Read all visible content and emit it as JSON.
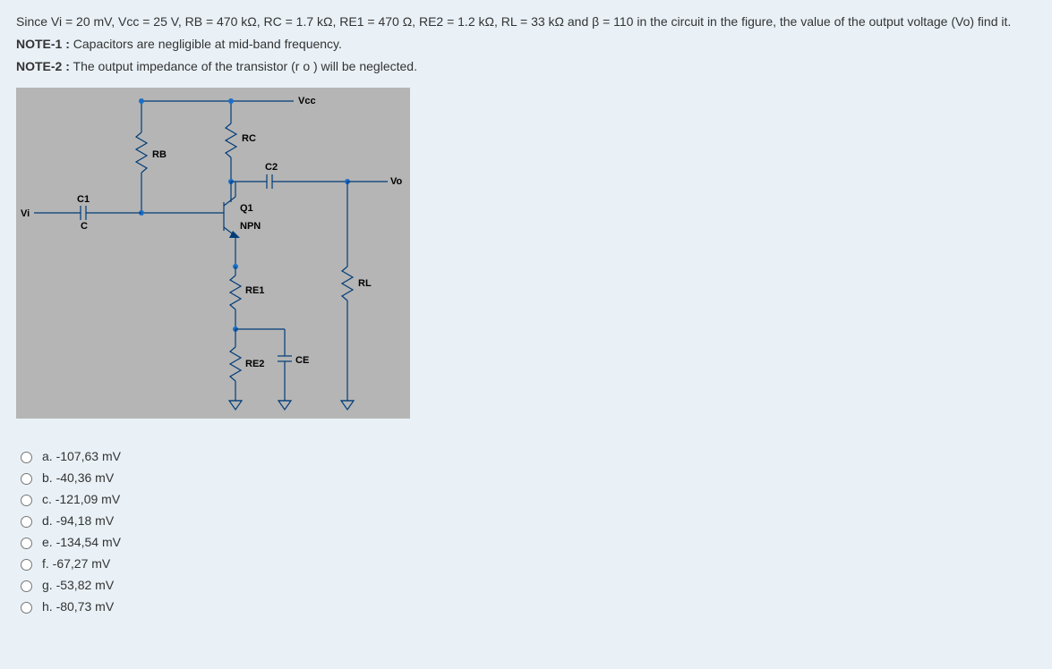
{
  "question": {
    "line1": "Since Vi = 20 mV, Vcc = 25 V, RB = 470 kΩ, RC = 1.7 kΩ, RE1 = 470 Ω, RE2 = 1.2 kΩ, RL = 33 kΩ and β = 110 in the circuit in the figure, the value of the output voltage (Vo) find it.",
    "note1_label": "NOTE-1 :",
    "note1_text": " Capacitors are negligible at mid-band frequency.",
    "note2_label": "NOTE-2 :",
    "note2_text": " The output impedance of the transistor (r o ) will be neglected."
  },
  "circuit_labels": {
    "vcc": "Vcc",
    "vi": "Vi",
    "vo": "Vo",
    "rb": "RB",
    "rc": "RC",
    "c1": "C1",
    "c": "C",
    "c2": "C2",
    "q1": "Q1",
    "npn": "NPN",
    "re1": "RE1",
    "re2": "RE2",
    "ce": "CE",
    "rl": "RL"
  },
  "options": [
    {
      "key": "a",
      "label": "a. -107,63 mV"
    },
    {
      "key": "b",
      "label": "b. -40,36 mV"
    },
    {
      "key": "c",
      "label": "c. -121,09 mV"
    },
    {
      "key": "d",
      "label": "d. -94,18 mV"
    },
    {
      "key": "e",
      "label": "e. -134,54 mV"
    },
    {
      "key": "f",
      "label": "f. -67,27 mV"
    },
    {
      "key": "g",
      "label": "g. -53,82 mV"
    },
    {
      "key": "h",
      "label": "h. -80,73 mV"
    }
  ]
}
